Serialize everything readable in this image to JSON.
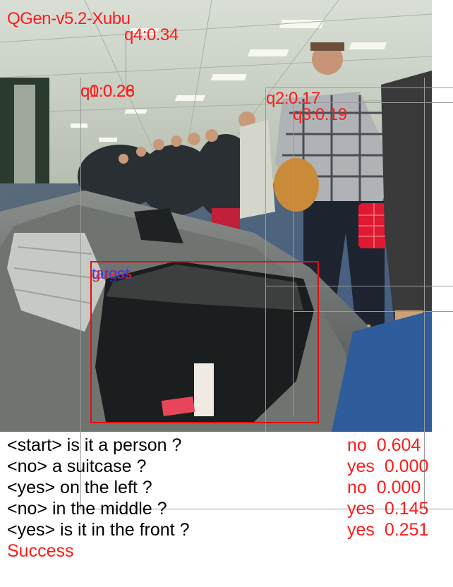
{
  "model_label": "QGen-v5.2-Xubu",
  "candidate_labels": {
    "q4": "q4:0.34",
    "q0": "q0:0.26",
    "q1": "q1:0.28",
    "q2": "q2:0.17",
    "q3": "q3:0.19",
    "guess": "guess",
    "target": "target"
  },
  "dialogue": [
    {
      "question": "<start> is it a person ?",
      "answer": "no",
      "prob": "0.604"
    },
    {
      "question": "<no> a suitcase ?",
      "answer": "yes",
      "prob": "0.000"
    },
    {
      "question": "<yes> on the left ?",
      "answer": "no",
      "prob": "0.000"
    },
    {
      "question": "<no> in the middle ?",
      "answer": "yes",
      "prob": "0.145"
    },
    {
      "question": "<yes> is it in the front ?",
      "answer": "yes",
      "prob": "0.251"
    }
  ],
  "result": "Success",
  "colors": {
    "label_red": "#ff1a1a",
    "label_blue": "#1a3cff",
    "box_red": "#e01010",
    "line_gray": "#9a9a9a"
  }
}
